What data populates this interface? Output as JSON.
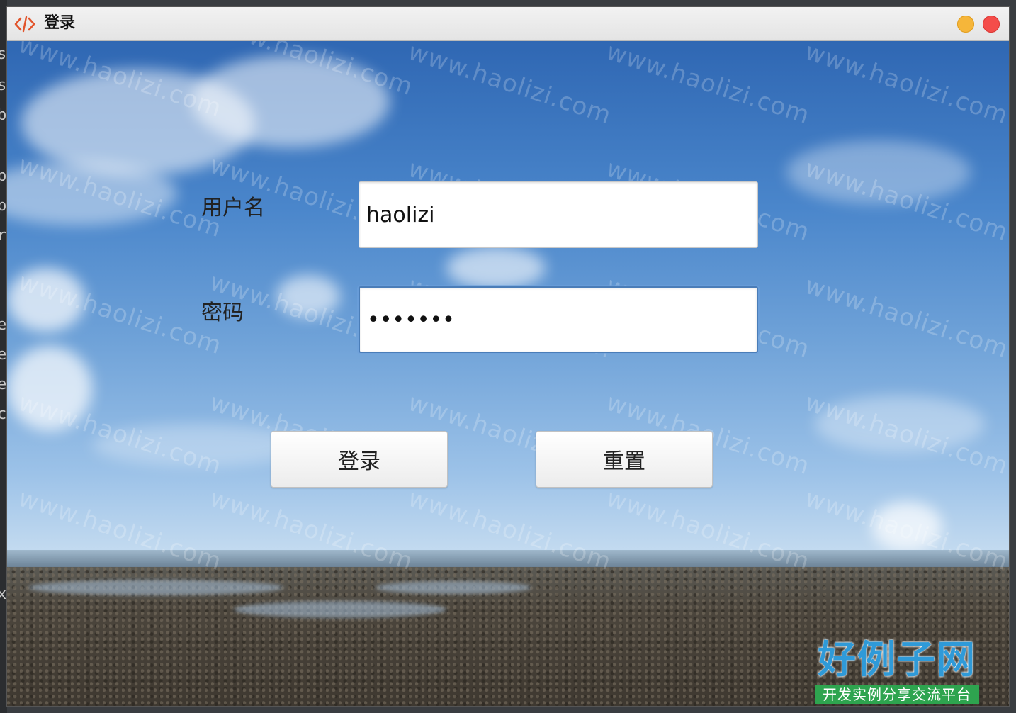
{
  "window": {
    "title": "登录"
  },
  "form": {
    "username_label": "用户名",
    "username_value": "haolizi",
    "password_label": "密码",
    "password_value": "1234567"
  },
  "buttons": {
    "login_label": "登录",
    "reset_label": "重置"
  },
  "watermark": {
    "text": "www.haolizi.com"
  },
  "brand": {
    "name": "好例子网",
    "tagline": "开发实例分享交流平台"
  },
  "colors": {
    "minimize": "#f6b63a",
    "close": "#f44d4a",
    "focus_ring": "#4a7db8",
    "brand_blue": "#2f9ad8",
    "brand_green": "#2ea44f"
  },
  "icons": {
    "app": "code-brackets-icon"
  }
}
